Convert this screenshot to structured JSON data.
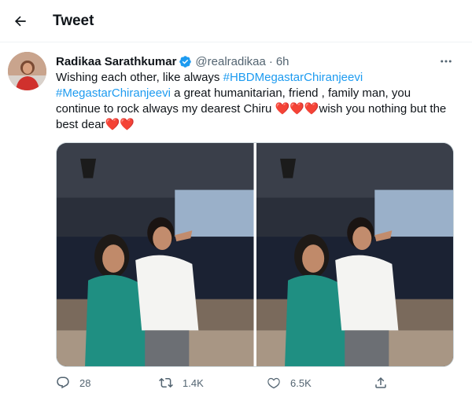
{
  "header": {
    "title": "Tweet"
  },
  "tweet": {
    "author_name": "Radikaa Sarathkumar",
    "handle": "@realradikaa",
    "separator": "·",
    "time": "6h",
    "text": {
      "line1_prefix": "Wishing each other, like always ",
      "hashtag1": "#HBDMegastarChiranjeevi",
      "hashtag2": "#MegastarChiranjeevi",
      "line2_suffix": " a great humanitarian, friend , family man, you",
      "line3_prefix": "continue to rock always my dearest Chiru ",
      "hearts3": "❤️❤️❤️",
      "line3_suffix": "wish you nothing but the",
      "line4_prefix": "best dear",
      "hearts4": "❤️❤️"
    }
  },
  "actions": {
    "reply_count": "28",
    "retweet_count": "1.4K",
    "like_count": "6.5K"
  },
  "colors": {
    "accent": "#1d9bf0",
    "text": "#0f1419",
    "muted": "#536471",
    "heart": "#e0245e"
  },
  "icons": {
    "back": "arrow-left-icon",
    "verified": "verified-badge-icon",
    "more": "more-horizontal-icon",
    "reply": "reply-icon",
    "retweet": "retweet-icon",
    "like": "heart-icon",
    "share": "share-icon"
  }
}
